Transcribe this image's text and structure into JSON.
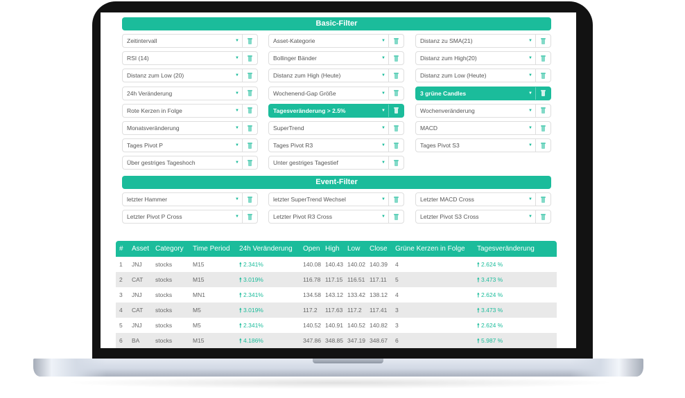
{
  "basic_filter": {
    "title": "Basic-Filter",
    "items": [
      {
        "label": "Zeitintervall",
        "active": false
      },
      {
        "label": "Asset-Kategorie",
        "active": false
      },
      {
        "label": "Distanz zu SMA(21)",
        "active": false
      },
      {
        "label": "RSI (14)",
        "active": false
      },
      {
        "label": "Bollinger Bänder",
        "active": false
      },
      {
        "label": "Distanz zum High(20)",
        "active": false
      },
      {
        "label": "Distanz zum Low (20)",
        "active": false
      },
      {
        "label": "Distanz zum High (Heute)",
        "active": false
      },
      {
        "label": "Distanz zum Low (Heute)",
        "active": false
      },
      {
        "label": "24h Veränderung",
        "active": false
      },
      {
        "label": "Wochenend-Gap Größe",
        "active": false
      },
      {
        "label": "3 grüne Candles",
        "active": true
      },
      {
        "label": "Rote Kerzen in Folge",
        "active": false
      },
      {
        "label": "Tagesveränderung > 2.5%",
        "active": true
      },
      {
        "label": "Wochenveränderung",
        "active": false
      },
      {
        "label": "Monatsveränderung",
        "active": false
      },
      {
        "label": "SuperTrend",
        "active": false
      },
      {
        "label": "MACD",
        "active": false
      },
      {
        "label": "Tages Pivot P",
        "active": false
      },
      {
        "label": "Tages Pivot R3",
        "active": false
      },
      {
        "label": "Tages Pivot S3",
        "active": false
      },
      {
        "label": "Über gestriges Tageshoch",
        "active": false
      },
      {
        "label": "Unter gestriges Tagestief",
        "active": false
      }
    ]
  },
  "event_filter": {
    "title": "Event-Filter",
    "items": [
      {
        "label": "letzter Hammer",
        "active": false
      },
      {
        "label": "letzter SuperTrend Wechsel",
        "active": false
      },
      {
        "label": "Letzter MACD Cross",
        "active": false
      },
      {
        "label": "Letzter Pivot P Cross",
        "active": false
      },
      {
        "label": "Letzter Pivot R3 Cross",
        "active": false
      },
      {
        "label": "Letzter Pivot S3 Cross",
        "active": false
      }
    ]
  },
  "icons": {
    "caret": "▼",
    "trash": "trash-icon",
    "up_arrow": "🠕"
  },
  "table": {
    "columns": [
      "#",
      "Asset",
      "Category",
      "Time Period",
      "24h Veränderung",
      "Open",
      "High",
      "Low",
      "Close",
      "Grüne Kerzen in Folge",
      "Tagesveränderung"
    ],
    "rows": [
      [
        "1",
        "JNJ",
        "stocks",
        "M15",
        "2.341%",
        "140.08",
        "140.43",
        "140.02",
        "140.39",
        "4",
        "2.624 %"
      ],
      [
        "2",
        "CAT",
        "stocks",
        "M15",
        "3.019%",
        "116.78",
        "117.15",
        "116.51",
        "117.11",
        "5",
        "3.473 %"
      ],
      [
        "3",
        "JNJ",
        "stocks",
        "MN1",
        "2.341%",
        "134.58",
        "143.12",
        "133.42",
        "138.12",
        "4",
        "2.624 %"
      ],
      [
        "4",
        "CAT",
        "stocks",
        "M5",
        "3.019%",
        "117.2",
        "117.63",
        "117.2",
        "117.41",
        "3",
        "3.473 %"
      ],
      [
        "5",
        "JNJ",
        "stocks",
        "M5",
        "2.341%",
        "140.52",
        "140.91",
        "140.52",
        "140.82",
        "3",
        "2.624 %"
      ],
      [
        "6",
        "BA",
        "stocks",
        "M15",
        "4.186%",
        "347.86",
        "348.85",
        "347.19",
        "348.67",
        "6",
        "5.987 %"
      ]
    ]
  },
  "colors": {
    "accent": "#1bbc9b",
    "row_alt": "#e9e9e9",
    "bezel": "#121212"
  }
}
